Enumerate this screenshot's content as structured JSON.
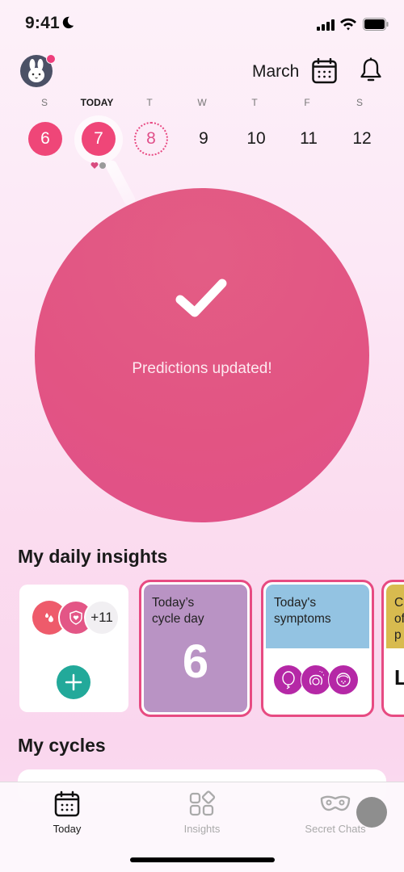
{
  "status_bar": {
    "time": "9:41",
    "icons": [
      "moon-icon",
      "signal-icon",
      "wifi-icon",
      "battery-icon"
    ]
  },
  "header": {
    "avatar_icon": "bunny-avatar",
    "has_notification_dot": true,
    "month": "March",
    "calendar_icon": "calendar-icon",
    "bell_icon": "bell-icon"
  },
  "week": {
    "weekdays": [
      "S",
      "TODAY",
      "T",
      "W",
      "T",
      "F",
      "S"
    ],
    "days": [
      {
        "num": "6",
        "state": "period"
      },
      {
        "num": "7",
        "state": "period-today"
      },
      {
        "num": "8",
        "state": "predicted"
      },
      {
        "num": "9",
        "state": "normal"
      },
      {
        "num": "10",
        "state": "normal"
      },
      {
        "num": "11",
        "state": "normal"
      },
      {
        "num": "12",
        "state": "normal"
      }
    ],
    "today_indicators": [
      "heart-icon",
      "gray-dot"
    ]
  },
  "prediction": {
    "icon": "checkmark-icon",
    "message": "Predictions updated!"
  },
  "insights": {
    "title": "My daily insights",
    "log_card": {
      "icons": [
        "droplets-icon",
        "shield-heart-icon"
      ],
      "more_count": "+11",
      "add_icon": "plus-icon"
    },
    "cards": [
      {
        "title_line1": "Today’s",
        "title_line2": "cycle day",
        "value": "6",
        "color": "#b993c4"
      },
      {
        "title_line1": "Today's",
        "title_line2": "symptoms",
        "icons": [
          "bloating-icon",
          "mood-icon",
          "acne-icon"
        ],
        "color": "#93c3e2"
      },
      {
        "title_line1": "C",
        "title_line2": "of",
        "title_line3": "p",
        "value": "L",
        "color": "#d8bb4f"
      }
    ]
  },
  "cycles": {
    "title": "My cycles"
  },
  "tab_bar": {
    "tabs": [
      {
        "label": "Today",
        "icon": "calendar-icon",
        "active": true
      },
      {
        "label": "Insights",
        "icon": "grid-icon",
        "active": false
      },
      {
        "label": "Secret Chats",
        "icon": "mask-icon",
        "active": false
      }
    ]
  },
  "colors": {
    "accent": "#ef4678",
    "circle": "#e2577f",
    "teal": "#22a99a",
    "symptom": "#b528a6"
  }
}
